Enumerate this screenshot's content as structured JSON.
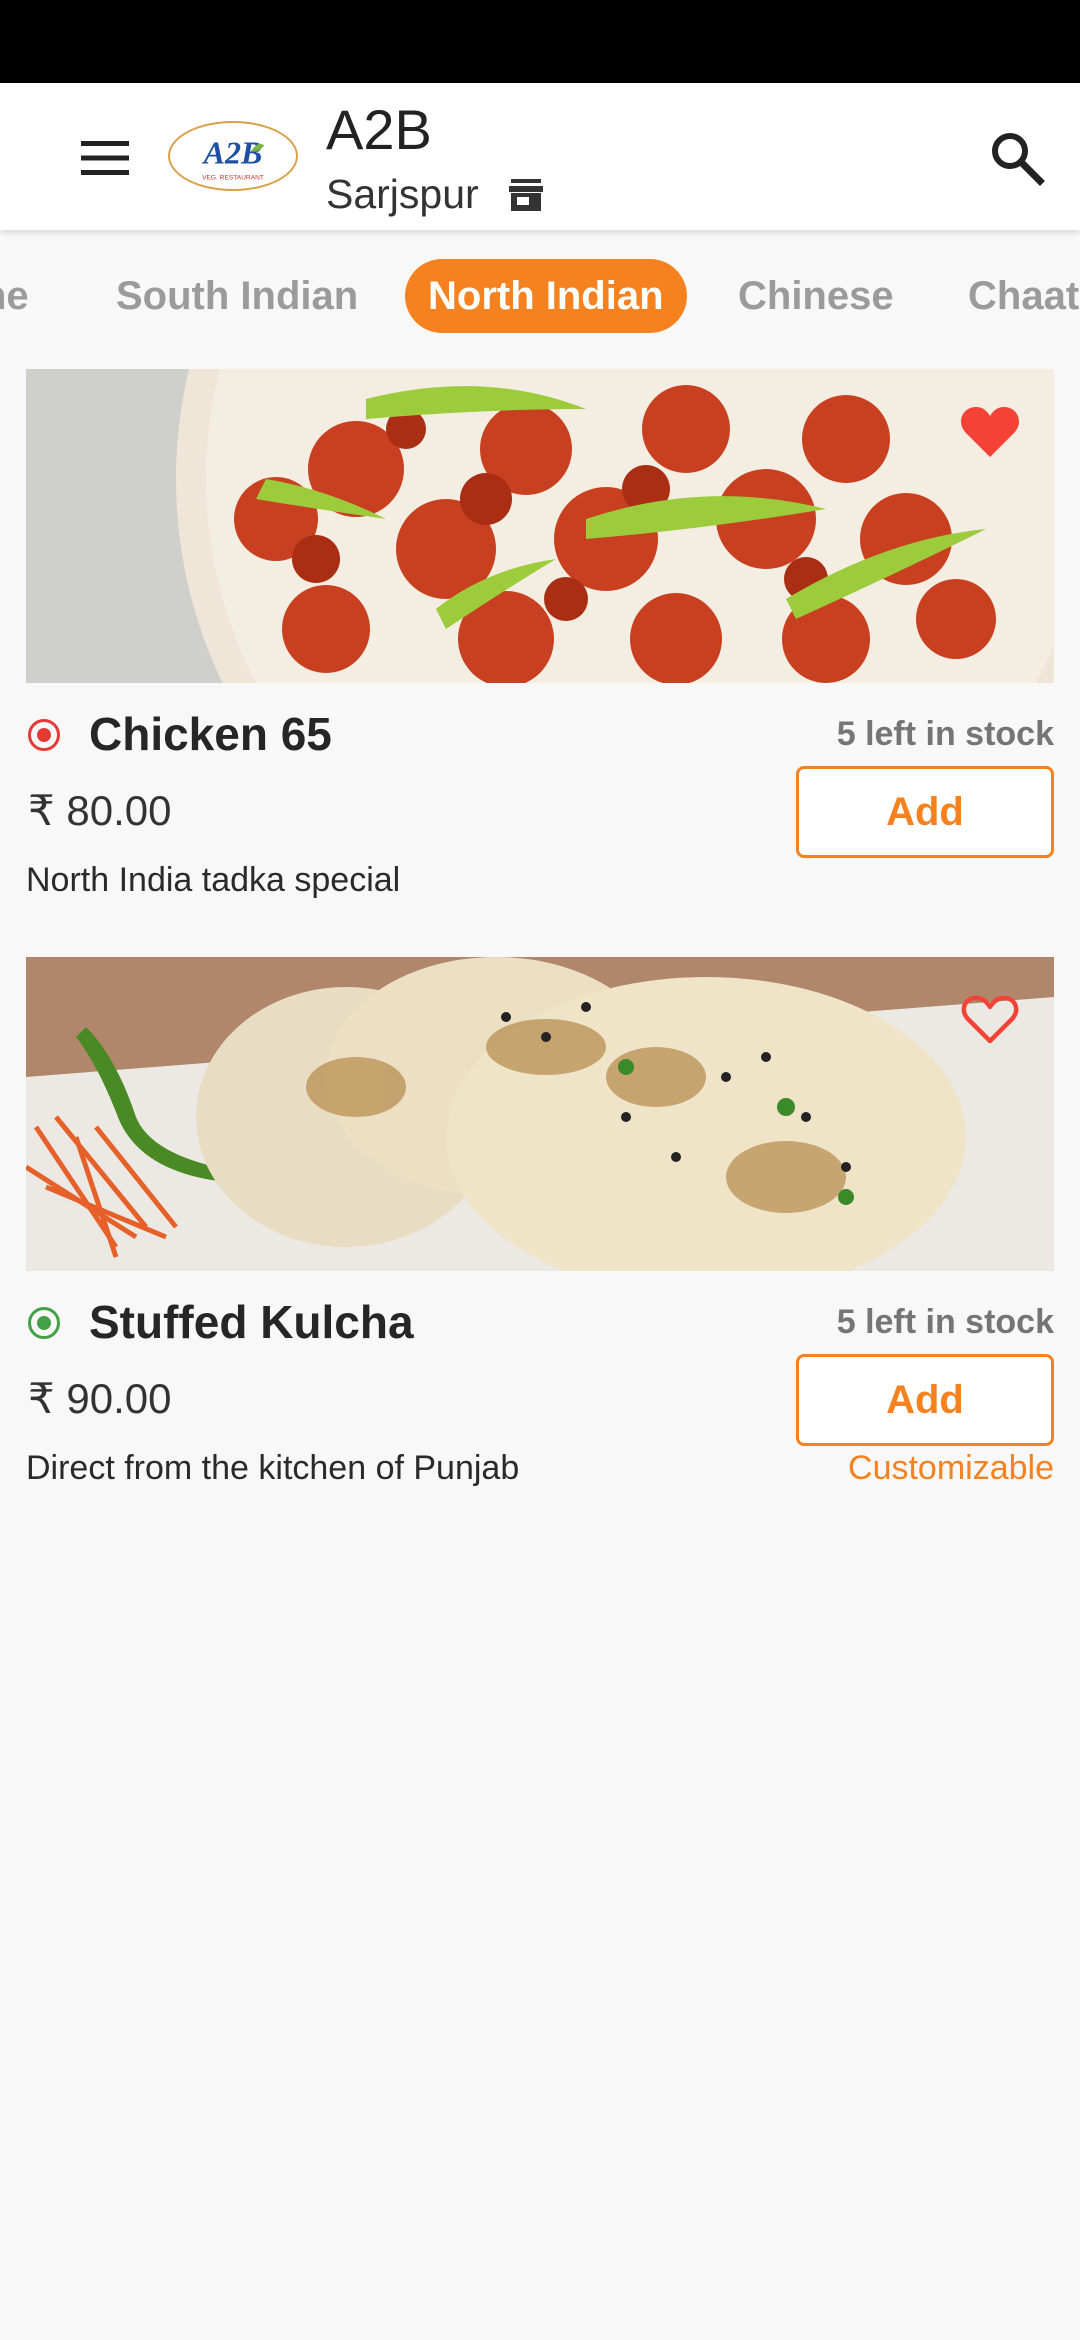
{
  "header": {
    "title": "A2B",
    "subtitle": "Sarjspur",
    "logo_text": "A2B",
    "logo_subtext": "VEG. RESTAURANT"
  },
  "categories": [
    {
      "label": "ne"
    },
    {
      "label": "South Indian"
    },
    {
      "label": "North Indian",
      "selected": true
    },
    {
      "label": "Chinese"
    },
    {
      "label": "Chaat"
    }
  ],
  "items": [
    {
      "name": "Chicken 65",
      "price": "₹ 80.00",
      "description": "North India tadka special",
      "stock": "5 left in stock",
      "add_label": "Add",
      "type": "non-veg",
      "favorite": true,
      "customizable_label": ""
    },
    {
      "name": "Stuffed Kulcha",
      "price": "₹ 90.00",
      "description": "Direct from the kitchen of Punjab",
      "stock": "5 left in stock",
      "add_label": "Add",
      "type": "veg",
      "favorite": false,
      "customizable_label": "Customizable"
    }
  ],
  "colors": {
    "accent": "#f6821f",
    "nonveg": "#e53935",
    "veg": "#43a047",
    "favorite": "#f44336"
  }
}
